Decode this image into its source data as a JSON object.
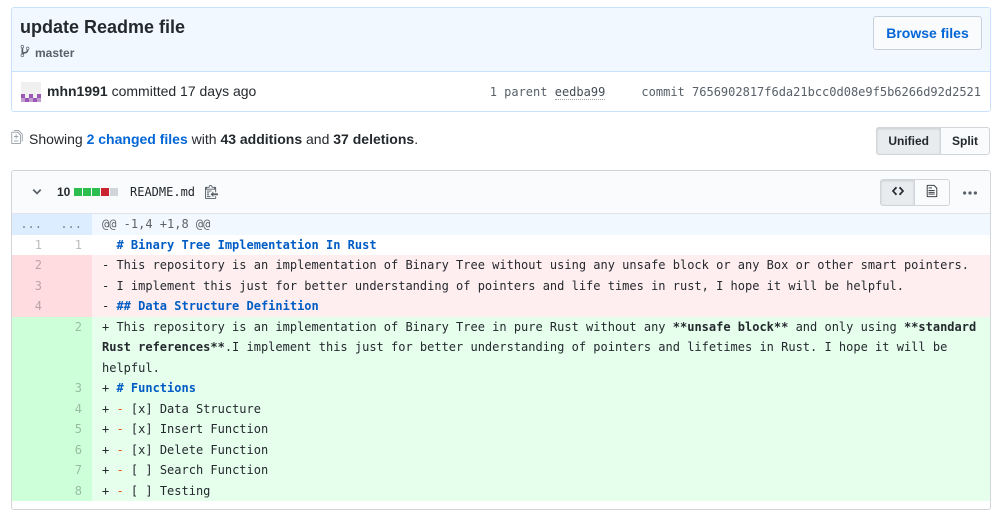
{
  "commit": {
    "title": "update Readme file",
    "branch": "master",
    "browse_label": "Browse files",
    "author": "mhn1991",
    "committed_text": "committed 17 days ago",
    "parent_label": "1 parent",
    "parent_sha": "eedba99",
    "commit_label": "commit",
    "commit_sha": "7656902817f6da21bcc0d08e9f5b6266d92d2521"
  },
  "toc": {
    "showing": "Showing",
    "changed_files": "2 changed files",
    "with": "with",
    "additions": "43 additions",
    "and": "and",
    "deletions": "37 deletions",
    "period": "."
  },
  "view_toggle": {
    "unified": "Unified",
    "split": "Split"
  },
  "file": {
    "diffstat_count": "10",
    "diffstat_blocks": [
      "#2cbe4e",
      "#2cbe4e",
      "#2cbe4e",
      "#cb2431",
      "#d1d5da"
    ],
    "name": "README.md"
  },
  "diff": {
    "hunk": {
      "old": "...",
      "new": "...",
      "text": "@@ -1,4 +1,8 @@"
    },
    "lines": [
      {
        "type": "ctx",
        "old": "1",
        "new": "1",
        "prefix": " ",
        "text": " # Binary Tree Implementation In Rust"
      },
      {
        "type": "del",
        "old": "2",
        "new": "",
        "prefix": "-",
        "text": " This repository is an implementation of Binary Tree without using any unsafe block or any Box or other smart pointers."
      },
      {
        "type": "del",
        "old": "3",
        "new": "",
        "prefix": "-",
        "text": " I implement this just for better understanding of pointers and life times in rust, I hope it will be helpful."
      },
      {
        "type": "del",
        "old": "4",
        "new": "",
        "prefix": "-",
        "text": " ## Data Structure Definition"
      },
      {
        "type": "add",
        "old": "",
        "new": "2",
        "prefix": "+",
        "text": " This repository is an implementation of Binary Tree in pure Rust without any **unsafe block** and only using **standard Rust references**.I implement this just for better understanding of pointers and lifetimes in Rust. I hope it will be helpful."
      },
      {
        "type": "add",
        "old": "",
        "new": "3",
        "prefix": "+",
        "text": " # Functions"
      },
      {
        "type": "add",
        "old": "",
        "new": "4",
        "prefix": "+",
        "text": " - [x] Data Structure"
      },
      {
        "type": "add",
        "old": "",
        "new": "5",
        "prefix": "+",
        "text": " - [x] Insert Function"
      },
      {
        "type": "add",
        "old": "",
        "new": "6",
        "prefix": "+",
        "text": " - [x] Delete Function"
      },
      {
        "type": "add",
        "old": "",
        "new": "7",
        "prefix": "+",
        "text": " - [ ] Search Function"
      },
      {
        "type": "add",
        "old": "",
        "new": "8",
        "prefix": "+",
        "text": " - [ ] Testing"
      }
    ]
  }
}
